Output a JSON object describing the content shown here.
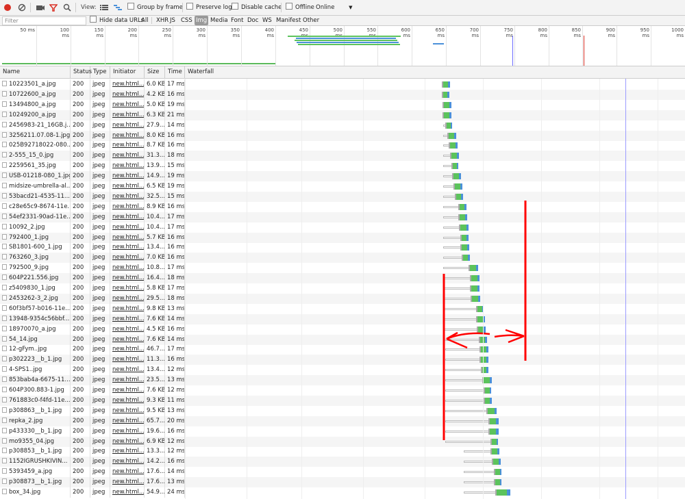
{
  "toolbar": {
    "view_label": "View:",
    "group_by_frame": "Group by frame",
    "preserve_log": "Preserve log",
    "disable_cache": "Disable cache",
    "offline": "Offline",
    "throttle": "Online"
  },
  "filter": {
    "placeholder": "Filter",
    "hide_data_urls": "Hide data URLs",
    "types": [
      "All",
      "XHR",
      "JS",
      "CSS",
      "Img",
      "Media",
      "Font",
      "Doc",
      "WS",
      "Manifest",
      "Other"
    ],
    "selected_type": "Img"
  },
  "overview": {
    "tick_labels": [
      "50 ms",
      "100 ms",
      "150 ms",
      "200 ms",
      "250 ms",
      "300 ms",
      "350 ms",
      "400 ms",
      "450 ms",
      "500 ms",
      "550 ms",
      "600 ms",
      "650 ms",
      "700 ms",
      "750 ms",
      "800 ms",
      "850 ms",
      "900 ms",
      "950 ms",
      "1000 ms"
    ]
  },
  "columns": {
    "name": "Name",
    "status": "Status",
    "type": "Type",
    "initiator": "Initiator",
    "size": "Size",
    "time": "Time",
    "waterfall": "Waterfall"
  },
  "rows": [
    {
      "name": "10223501_a.jpg",
      "status": "200",
      "type": "jpeg",
      "initiator": "new.html...",
      "size": "6.0 KB",
      "time": "17 ms"
    },
    {
      "name": "10722600_a.jpg",
      "status": "200",
      "type": "jpeg",
      "initiator": "new.html...",
      "size": "4.2 KB",
      "time": "16 ms"
    },
    {
      "name": "13494800_a.jpg",
      "status": "200",
      "type": "jpeg",
      "initiator": "new.html...",
      "size": "5.0 KB",
      "time": "19 ms"
    },
    {
      "name": "10249200_a.jpg",
      "status": "200",
      "type": "jpeg",
      "initiator": "new.html...",
      "size": "6.3 KB",
      "time": "21 ms"
    },
    {
      "name": "2456983-21_16GB.j...",
      "status": "200",
      "type": "jpeg",
      "initiator": "new.html...",
      "size": "27.9...",
      "time": "14 ms"
    },
    {
      "name": "3256211.07.08-1.jpg",
      "status": "200",
      "type": "jpeg",
      "initiator": "new.html...",
      "size": "8.0 KB",
      "time": "16 ms"
    },
    {
      "name": "025B92718022-080...",
      "status": "200",
      "type": "jpeg",
      "initiator": "new.html...",
      "size": "8.7 KB",
      "time": "16 ms"
    },
    {
      "name": "2-555_15_0.jpg",
      "status": "200",
      "type": "jpeg",
      "initiator": "new.html...",
      "size": "31.3...",
      "time": "18 ms"
    },
    {
      "name": "2259561_35.jpg",
      "status": "200",
      "type": "jpeg",
      "initiator": "new.html...",
      "size": "13.9...",
      "time": "15 ms"
    },
    {
      "name": "USB-01218-080_1.jpg",
      "status": "200",
      "type": "jpeg",
      "initiator": "new.html...",
      "size": "14.9...",
      "time": "19 ms"
    },
    {
      "name": "midsize-umbrella-al...",
      "status": "200",
      "type": "jpeg",
      "initiator": "new.html...",
      "size": "6.5 KB",
      "time": "19 ms"
    },
    {
      "name": "53bacd21-4535-11...",
      "status": "200",
      "type": "jpeg",
      "initiator": "new.html...",
      "size": "32.5...",
      "time": "15 ms"
    },
    {
      "name": "c28e65c9-8674-11e...",
      "status": "200",
      "type": "jpeg",
      "initiator": "new.html...",
      "size": "8.9 KB",
      "time": "16 ms"
    },
    {
      "name": "54ef2331-90ad-11e...",
      "status": "200",
      "type": "jpeg",
      "initiator": "new.html...",
      "size": "10.4...",
      "time": "17 ms"
    },
    {
      "name": "10092_2.jpg",
      "status": "200",
      "type": "jpeg",
      "initiator": "new.html...",
      "size": "10.4...",
      "time": "17 ms"
    },
    {
      "name": "792400_1.jpg",
      "status": "200",
      "type": "jpeg",
      "initiator": "new.html...",
      "size": "5.7 KB",
      "time": "16 ms"
    },
    {
      "name": "SB1801-600_1.jpg",
      "status": "200",
      "type": "jpeg",
      "initiator": "new.html...",
      "size": "13.4...",
      "time": "16 ms"
    },
    {
      "name": "763260_3.jpg",
      "status": "200",
      "type": "jpeg",
      "initiator": "new.html...",
      "size": "7.0 KB",
      "time": "16 ms"
    },
    {
      "name": "792500_9.jpg",
      "status": "200",
      "type": "jpeg",
      "initiator": "new.html...",
      "size": "10.8...",
      "time": "17 ms"
    },
    {
      "name": "604P221.556.jpg",
      "status": "200",
      "type": "jpeg",
      "initiator": "new.html...",
      "size": "16.4...",
      "time": "18 ms"
    },
    {
      "name": "z5409830_1.jpg",
      "status": "200",
      "type": "jpeg",
      "initiator": "new.html...",
      "size": "5.8 KB",
      "time": "17 ms"
    },
    {
      "name": "2453262-3_2.jpg",
      "status": "200",
      "type": "jpeg",
      "initiator": "new.html...",
      "size": "29.5...",
      "time": "18 ms"
    },
    {
      "name": "60f3bf57-b016-11e...",
      "status": "200",
      "type": "jpeg",
      "initiator": "new.html...",
      "size": "9.8 KB",
      "time": "13 ms"
    },
    {
      "name": "13948-9354c56bbf...",
      "status": "200",
      "type": "jpeg",
      "initiator": "new.html...",
      "size": "7.6 KB",
      "time": "14 ms"
    },
    {
      "name": "18970070_a.jpg",
      "status": "200",
      "type": "jpeg",
      "initiator": "new.html...",
      "size": "4.5 KB",
      "time": "16 ms"
    },
    {
      "name": "54_14.jpg",
      "status": "200",
      "type": "jpeg",
      "initiator": "new.html...",
      "size": "7.6 KB",
      "time": "14 ms"
    },
    {
      "name": "12-gFym..jpg",
      "status": "200",
      "type": "jpeg",
      "initiator": "new.html...",
      "size": "46.7...",
      "time": "17 ms"
    },
    {
      "name": "p302223__b_1.jpg",
      "status": "200",
      "type": "jpeg",
      "initiator": "new.html...",
      "size": "11.3...",
      "time": "16 ms"
    },
    {
      "name": "4-SPS1..jpg",
      "status": "200",
      "type": "jpeg",
      "initiator": "new.html...",
      "size": "13.4...",
      "time": "12 ms"
    },
    {
      "name": "853bab4a-6675-11...",
      "status": "200",
      "type": "jpeg",
      "initiator": "new.html...",
      "size": "23.5...",
      "time": "13 ms"
    },
    {
      "name": "604P300.883-1.jpg",
      "status": "200",
      "type": "jpeg",
      "initiator": "new.html...",
      "size": "7.6 KB",
      "time": "12 ms"
    },
    {
      "name": "761883c0-f4fd-11e...",
      "status": "200",
      "type": "jpeg",
      "initiator": "new.html...",
      "size": "9.3 KB",
      "time": "11 ms"
    },
    {
      "name": "p308863__b_1.jpg",
      "status": "200",
      "type": "jpeg",
      "initiator": "new.html...",
      "size": "9.5 KB",
      "time": "13 ms"
    },
    {
      "name": "repka_2.jpg",
      "status": "200",
      "type": "jpeg",
      "initiator": "new.html...",
      "size": "65.7...",
      "time": "20 ms"
    },
    {
      "name": "p433330__b_1.jpg",
      "status": "200",
      "type": "jpeg",
      "initiator": "new.html...",
      "size": "19.6...",
      "time": "16 ms"
    },
    {
      "name": "mo9355_04.jpg",
      "status": "200",
      "type": "jpeg",
      "initiator": "new.html...",
      "size": "6.9 KB",
      "time": "12 ms"
    },
    {
      "name": "p308853__b_1.jpg",
      "status": "200",
      "type": "jpeg",
      "initiator": "new.html...",
      "size": "13.3...",
      "time": "12 ms"
    },
    {
      "name": "1152IGRUSHKIVIN...",
      "status": "200",
      "type": "jpeg",
      "initiator": "new.html...",
      "size": "14.2...",
      "time": "16 ms"
    },
    {
      "name": "5393459_a.jpg",
      "status": "200",
      "type": "jpeg",
      "initiator": "new.html...",
      "size": "17.6...",
      "time": "14 ms"
    },
    {
      "name": "p308873__b_1.jpg",
      "status": "200",
      "type": "jpeg",
      "initiator": "new.html...",
      "size": "17.6...",
      "time": "13 ms"
    },
    {
      "name": "box_34.jpg",
      "status": "200",
      "type": "jpeg",
      "initiator": "new.html...",
      "size": "54.9...",
      "time": "24 ms"
    }
  ],
  "waterfall_ms": {
    "queued": [
      647,
      647,
      647,
      647,
      647,
      647,
      647,
      647,
      647,
      647,
      647,
      647,
      647,
      647,
      647,
      647,
      647,
      647,
      647,
      647,
      647,
      647,
      647,
      647,
      647,
      647,
      650,
      650,
      650,
      650,
      650,
      650,
      650,
      650,
      650,
      650,
      680,
      680,
      680,
      680,
      680
    ],
    "start": [
      647,
      647,
      648,
      648,
      652,
      656,
      658,
      660,
      662,
      664,
      666,
      668,
      674,
      674,
      675,
      677,
      677,
      679,
      690,
      693,
      693,
      694,
      702,
      703,
      704,
      707,
      708,
      708,
      710,
      713,
      715,
      715,
      719,
      722,
      722,
      726,
      726,
      728,
      731,
      731,
      734
    ],
    "end": [
      658,
      657,
      660,
      660,
      662,
      668,
      670,
      673,
      672,
      676,
      678,
      679,
      685,
      686,
      688,
      688,
      689,
      690,
      704,
      706,
      706,
      707,
      713,
      715,
      716,
      718,
      720,
      720,
      720,
      726,
      725,
      726,
      734,
      737,
      737,
      736,
      738,
      740,
      742,
      742,
      756
    ]
  },
  "colors": {
    "record_red": "#d93025",
    "filter_red": "#d93025",
    "waiting_green": "#5cc35c",
    "download_blue": "#4a90d9",
    "annotation_red": "#ff0000",
    "dom_content_loaded_blue": "#6b6bff",
    "load_red": "#d93025"
  },
  "icons": [
    "record-icon",
    "clear-icon",
    "camera-icon",
    "filter-icon",
    "search-icon",
    "list-view-icon",
    "waterfall-view-icon",
    "dropdown-arrow-icon"
  ]
}
